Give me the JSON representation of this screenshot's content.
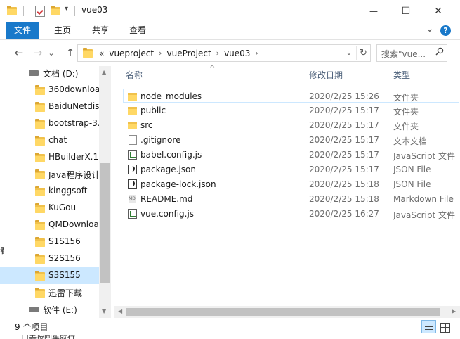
{
  "window": {
    "title": "vue03",
    "controls": {
      "minimize": "—",
      "maximize": "☐",
      "close": "✕"
    }
  },
  "ribbon": {
    "tabs": [
      "文件",
      "主页",
      "共享",
      "查看"
    ],
    "expand": "⌄",
    "help": "?"
  },
  "navigation": {
    "back": "←",
    "forward": "→",
    "recent": "⌄",
    "up": "↑"
  },
  "address": {
    "overflow": "«",
    "crumbs": [
      "vueproject",
      "vueProject",
      "vue03"
    ],
    "dropdown": "⌄",
    "refresh": "↻"
  },
  "search": {
    "placeholder": "搜索\"vue...",
    "icon": "🔍"
  },
  "tree": [
    {
      "label": "文档 (D:)",
      "kind": "drive"
    },
    {
      "label": "360downloa",
      "kind": "folder"
    },
    {
      "label": "BaiduNetdis",
      "kind": "folder"
    },
    {
      "label": "bootstrap-3.",
      "kind": "folder"
    },
    {
      "label": "chat",
      "kind": "folder"
    },
    {
      "label": "HBuilderX.1.",
      "kind": "folder"
    },
    {
      "label": "Java程序设计",
      "kind": "folder"
    },
    {
      "label": "kinggsoft",
      "kind": "folder"
    },
    {
      "label": "KuGou",
      "kind": "folder"
    },
    {
      "label": "QMDownloa",
      "kind": "folder"
    },
    {
      "label": "S1S156",
      "kind": "folder"
    },
    {
      "label": "S2S156",
      "kind": "folder"
    },
    {
      "label": "S3S155",
      "kind": "folder",
      "selected": true
    },
    {
      "label": "迅雷下载",
      "kind": "folder"
    },
    {
      "label": "软件 (E:)",
      "kind": "drive"
    }
  ],
  "columns": {
    "name": "名称",
    "date": "修改日期",
    "type": "类型",
    "sort_indicator": "^"
  },
  "files": [
    {
      "name": "node_modules",
      "date": "2020/2/25 15:26",
      "type": "文件夹",
      "icon": "folder"
    },
    {
      "name": "public",
      "date": "2020/2/25 15:17",
      "type": "文件夹",
      "icon": "folder"
    },
    {
      "name": "src",
      "date": "2020/2/25 15:17",
      "type": "文件夹",
      "icon": "folder"
    },
    {
      "name": ".gitignore",
      "date": "2020/2/25 15:17",
      "type": "文本文档",
      "icon": "doc"
    },
    {
      "name": "babel.config.js",
      "date": "2020/2/25 15:17",
      "type": "JavaScript 文件",
      "icon": "js"
    },
    {
      "name": "package.json",
      "date": "2020/2/25 15:17",
      "type": "JSON File",
      "icon": "json"
    },
    {
      "name": "package-lock.json",
      "date": "2020/2/25 15:18",
      "type": "JSON File",
      "icon": "json"
    },
    {
      "name": "README.md",
      "date": "2020/2/25 15:18",
      "type": "Markdown File",
      "icon": "md"
    },
    {
      "name": "vue.config.js",
      "date": "2020/2/25 16:27",
      "type": "JavaScript 文件",
      "icon": "js"
    }
  ],
  "status": {
    "count": "9 个项目"
  },
  "background": {
    "left_glyph": "看",
    "bottom_text": "口等按回车就行"
  }
}
